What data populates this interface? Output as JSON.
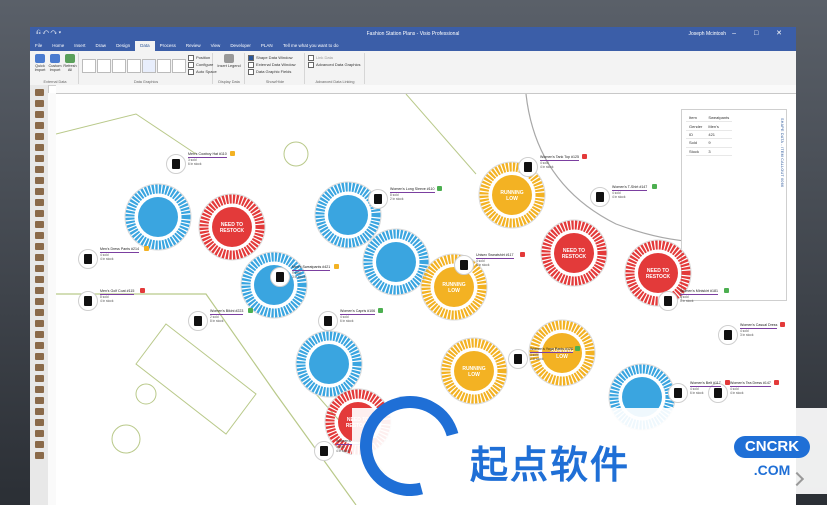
{
  "window": {
    "title": "Fashion Station Plans - Visio Professional",
    "user": "Joseph Mcintosh",
    "controls": "–  □  ✕"
  },
  "menu": {
    "items": [
      "File",
      "Home",
      "Insert",
      "Draw",
      "Design",
      "Data",
      "Process",
      "Review",
      "View",
      "Developer",
      "PLAN"
    ],
    "active_index": 5,
    "tell_me": "Tell me what you want to do"
  },
  "ribbon": {
    "quick_import": "Quick Import",
    "custom_import": "Custom Import",
    "refresh_all": "Refresh All",
    "external_data_label": "External Data",
    "data_graphics_label": "Data Graphics",
    "position": "Position",
    "configure": "Configure",
    "auto_space": "Auto Space",
    "insert_legend": "Insert Legend",
    "display_data_label": "Display Data",
    "shape_data_window": "Shape Data Window",
    "external_data_window": "External Data Window",
    "data_graphic_fields": "Data Graphic Fields",
    "show_hide_label": "Show/Hide",
    "link_data": "Link Data",
    "advanced_data_graphics": "Advanced Data Graphics",
    "advanced_data_linking_label": "Advanced Data Linking"
  },
  "shape_data": {
    "vertical_title": "SHAPE DATA - ITEM CALLOUT 0066",
    "rows": [
      {
        "k": "Item",
        "v": "Sweatpants"
      },
      {
        "k": "Gender",
        "v": "Men's"
      },
      {
        "k": "ID",
        "v": "421"
      },
      {
        "k": "Sold",
        "v": "9"
      },
      {
        "k": "Stock",
        "v": "3"
      }
    ]
  },
  "gauges": [
    {
      "label": "",
      "colors": {
        "ring": "#3aa5e0",
        "fill": "#3aa5e0"
      }
    },
    {
      "label": "NEED TO RESTOCK",
      "colors": {
        "ring": "#e33a3a",
        "fill": "#e33a3a"
      }
    },
    {
      "label": "",
      "colors": {
        "ring": "#3aa5e0",
        "fill": "#3aa5e0"
      }
    },
    {
      "label": "",
      "colors": {
        "ring": "#3aa5e0",
        "fill": "#3aa5e0"
      }
    },
    {
      "label": "",
      "colors": {
        "ring": "#3aa5e0",
        "fill": "#3aa5e0"
      }
    },
    {
      "label": "RUNNING LOW",
      "colors": {
        "ring": "#f3b223",
        "fill": "#f3b223"
      }
    },
    {
      "label": "RUNNING LOW",
      "colors": {
        "ring": "#f3b223",
        "fill": "#f3b223"
      }
    },
    {
      "label": "NEED TO RESTOCK",
      "colors": {
        "ring": "#e33a3a",
        "fill": "#e33a3a"
      }
    },
    {
      "label": "NEED TO RESTOCK",
      "colors": {
        "ring": "#e33a3a",
        "fill": "#e33a3a"
      }
    },
    {
      "label": "",
      "colors": {
        "ring": "#3aa5e0",
        "fill": "#3aa5e0"
      }
    },
    {
      "label": "RUNNING LOW",
      "colors": {
        "ring": "#f3b223",
        "fill": "#f3b223"
      }
    },
    {
      "label": "RUNNING LOW",
      "colors": {
        "ring": "#f3b223",
        "fill": "#f3b223"
      }
    },
    {
      "label": "NEED TO RESTOCK",
      "colors": {
        "ring": "#e33a3a",
        "fill": "#e33a3a"
      }
    },
    {
      "label": "",
      "colors": {
        "ring": "#3aa5e0",
        "fill": "#3aa5e0"
      }
    }
  ],
  "callouts": [
    {
      "name": "Men's Cowboy Hat #110",
      "sold": "3 sold",
      "stock": "6 in stock",
      "flag": "#f3b223"
    },
    {
      "name": "Men's Dress Pants #214",
      "sold": "4 sold",
      "stock": "4 in stock",
      "flag": "#f3b223"
    },
    {
      "name": "Men's Golf Coat #115",
      "sold": "8 sold",
      "stock": "4 in stock",
      "flag": "#e33a3a"
    },
    {
      "name": "Women's Bikini #223",
      "sold": "2 sold",
      "stock": "8 in stock",
      "flag": "#4caf50"
    },
    {
      "name": "Men's Sweatpants #421",
      "sold": "9 sold",
      "stock": "3 in stock",
      "flag": "#f3b223"
    },
    {
      "name": "Women's Long Sleeve #110",
      "sold": "8 sold",
      "stock": "2 in stock",
      "flag": "#4caf50"
    },
    {
      "name": "Women's Capris #106",
      "sold": "4 sold",
      "stock": "6 in stock",
      "flag": "#4caf50"
    },
    {
      "name": "Women's Tank Top #125",
      "sold": "4 sold",
      "stock": "4 in stock",
      "flag": "#e33a3a"
    },
    {
      "name": "Unisex Sweatshirt #117",
      "sold": "4 sold",
      "stock": "4 in stock",
      "flag": "#e33a3a"
    },
    {
      "name": "Women's T-Shirt #147",
      "sold": "4 sold",
      "stock": "4 in stock",
      "flag": "#4caf50"
    },
    {
      "name": "Women's Yoga Pants #126",
      "sold": "3 sold",
      "stock": "2 in stock",
      "flag": "#4caf50"
    },
    {
      "name": "Women's Miniskirt #181",
      "sold": "4 sold",
      "stock": "5 in stock",
      "flag": "#4caf50"
    },
    {
      "name": "Women's Casual Dress",
      "sold": "4 sold",
      "stock": "3 in stock",
      "flag": "#e33a3a"
    },
    {
      "name": "Women's Tea Dress #147",
      "sold": "4 sold",
      "stock": "4 in stock",
      "flag": "#e33a3a"
    },
    {
      "name": "Women's Belt #117",
      "sold": "4 sold",
      "stock": "6 in stock",
      "flag": "#e33a3a"
    },
    {
      "name": "Women's Jeans #122",
      "sold": "4 sold",
      "stock": "4 in stock",
      "flag": "#e33a3a"
    }
  ],
  "watermark": {
    "cn_text": "起点软件",
    "badge": "CNCRK",
    "domain": ".COM"
  },
  "icons": [
    "undo-icon",
    "redo-icon",
    "save-icon",
    "database-icon",
    "legend-icon",
    "checkbox-icon",
    "close-icon",
    "minimize-icon",
    "maximize-icon",
    "shirt-icon"
  ]
}
